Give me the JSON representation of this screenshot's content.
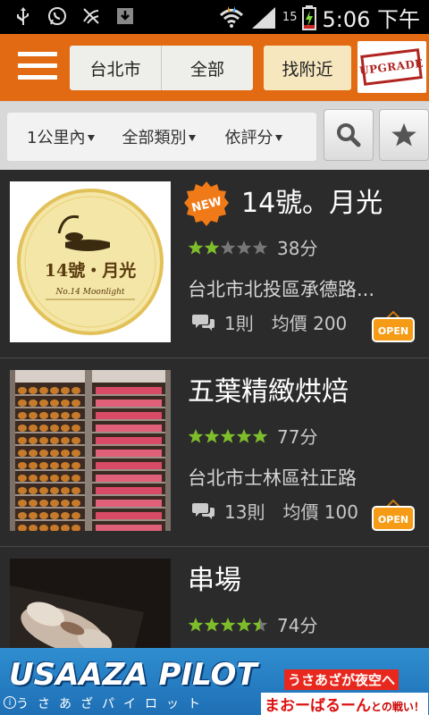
{
  "status_bar": {
    "battery_percent": "15",
    "time": "5:06 下午"
  },
  "toolbar": {
    "city": "台北市",
    "area": "全部",
    "nearby_label": "找附近",
    "upgrade_label": "UPGRADE"
  },
  "filters": {
    "distance": "1公里內",
    "category": "全部類別",
    "sort": "依評分"
  },
  "restaurants": [
    {
      "name": "14號。月光",
      "badge": "NEW",
      "stars": 2,
      "score": "38分",
      "address": "台北市北投區承德路...",
      "comments": "1則",
      "price": "均價 200",
      "status": "OPEN",
      "logo_text": "14號・月光",
      "logo_sub": "No.14 Moonlight"
    },
    {
      "name": "五葉精緻烘焙",
      "badge": "",
      "stars": 5,
      "score": "77分",
      "address": "台北市士林區社正路",
      "comments": "13則",
      "price": "均價 100",
      "status": "OPEN"
    },
    {
      "name": "串場",
      "badge": "",
      "stars": 4.5,
      "score": "74分",
      "address": "",
      "comments": "",
      "price": "",
      "status": ""
    }
  ],
  "ad": {
    "title": "USAAZA PILOT",
    "subtitle": "うさあざパイロット",
    "line1": "うさあざが夜空へ",
    "line2": "まおーばるーん",
    "line2_suffix": "との戦い！"
  },
  "colors": {
    "accent": "#e26a12",
    "star_on": "#7dbd2a",
    "star_off": "#777777",
    "open_badge": "#f59b16"
  }
}
